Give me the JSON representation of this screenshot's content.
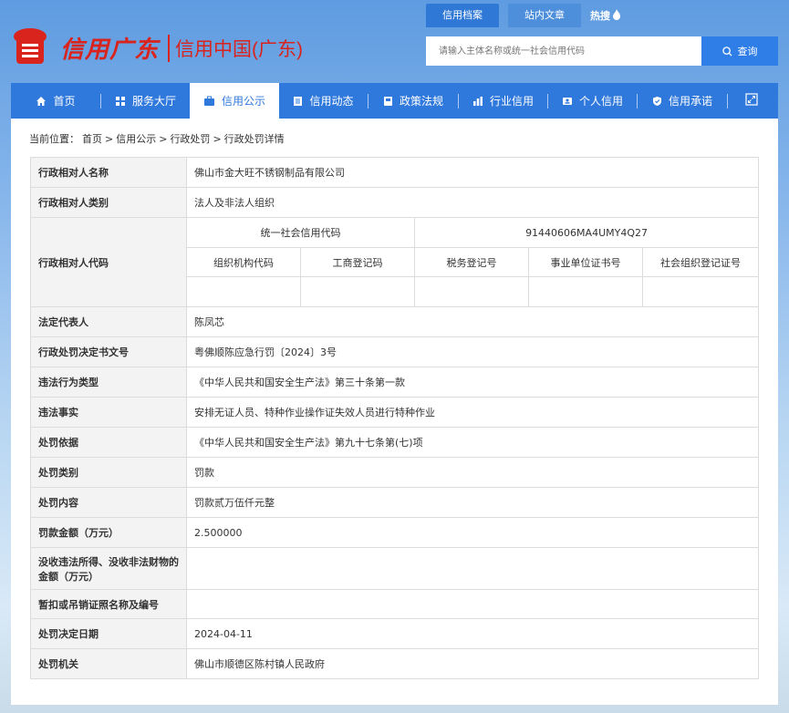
{
  "header": {
    "logo_script": "信用广东",
    "logo_name": "信用中国(广东)",
    "top_tabs": [
      {
        "label": "信用档案",
        "active": true
      },
      {
        "label": "站内文章",
        "active": false
      }
    ],
    "hot_label": "热搜",
    "search": {
      "placeholder": "请输入主体名称或统一社会信用代码",
      "button_label": "查询"
    }
  },
  "nav": {
    "items": [
      {
        "label": "首页",
        "icon": "home-icon"
      },
      {
        "label": "服务大厅",
        "icon": "grid-icon"
      },
      {
        "label": "信用公示",
        "icon": "briefcase-icon",
        "active": true
      },
      {
        "label": "信用动态",
        "icon": "document-icon"
      },
      {
        "label": "政策法规",
        "icon": "book-icon"
      },
      {
        "label": "行业信用",
        "icon": "chart-icon"
      },
      {
        "label": "个人信用",
        "icon": "id-card-icon"
      },
      {
        "label": "信用承诺",
        "icon": "shield-check-icon"
      }
    ],
    "expand_icon": "expand-icon"
  },
  "breadcrumb": {
    "prefix": "当前位置：",
    "items": [
      "首页",
      "信用公示",
      "行政处罚",
      "行政处罚详情"
    ],
    "separator": ">"
  },
  "detail": {
    "rows": [
      {
        "label": "行政相对人名称",
        "value": "佛山市金大旺不锈钢制品有限公司"
      },
      {
        "label": "行政相对人类别",
        "value": "法人及非法人组织"
      }
    ],
    "code_block": {
      "label": "行政相对人代码",
      "uscc_label": "统一社会信用代码",
      "uscc_value": "91440606MA4UMY4Q27",
      "sub_headers": [
        "组织机构代码",
        "工商登记码",
        "税务登记号",
        "事业单位证书号",
        "社会组织登记证号"
      ],
      "sub_values": [
        "",
        "",
        "",
        "",
        ""
      ]
    },
    "rows2": [
      {
        "label": "法定代表人",
        "value": "陈凤芯"
      },
      {
        "label": "行政处罚决定书文号",
        "value": "粤佛顺陈应急行罚〔2024〕3号"
      },
      {
        "label": "违法行为类型",
        "value": "《中华人民共和国安全生产法》第三十条第一款"
      },
      {
        "label": "违法事实",
        "value": "安排无证人员、特种作业操作证失效人员进行特种作业"
      },
      {
        "label": "处罚依据",
        "value": "《中华人民共和国安全生产法》第九十七条第(七)项"
      },
      {
        "label": "处罚类别",
        "value": "罚款"
      },
      {
        "label": "处罚内容",
        "value": "罚款贰万伍仟元整"
      },
      {
        "label": "罚款金额（万元）",
        "value": "2.500000"
      },
      {
        "label": "没收违法所得、没收非法财物的金额（万元）",
        "value": ""
      },
      {
        "label": "暂扣或吊销证照名称及编号",
        "value": ""
      },
      {
        "label": "处罚决定日期",
        "value": "2024-04-11"
      },
      {
        "label": "处罚机关",
        "value": "佛山市顺德区陈村镇人民政府"
      }
    ]
  },
  "colors": {
    "brand_red": "#d9231d",
    "nav_blue": "#2f78dc",
    "search_blue": "#2f7ee8"
  }
}
